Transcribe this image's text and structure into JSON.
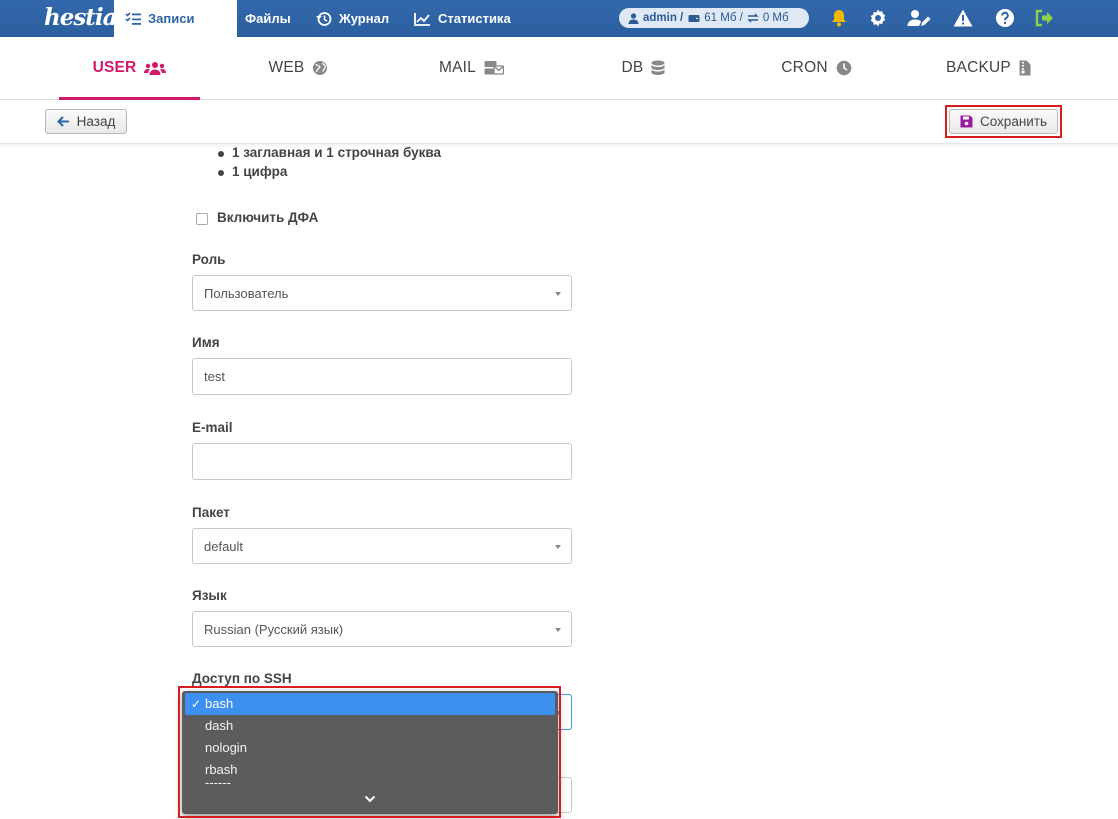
{
  "app": {
    "logo": "hestia"
  },
  "topnav": {
    "items": [
      {
        "label": "Записи",
        "icon": "list-check-icon",
        "active": true
      },
      {
        "label": "Файлы",
        "icon": "folder-icon",
        "active": false
      },
      {
        "label": "Журнал",
        "icon": "history-icon",
        "active": false
      },
      {
        "label": "Статистика",
        "icon": "chart-line-icon",
        "active": false
      }
    ],
    "user_pill": {
      "user": "admin /",
      "disk": "61 Мб /",
      "bandwidth": "0 Мб"
    },
    "icons": [
      "bell-icon",
      "gear-icon",
      "user-pen-icon",
      "warning-icon",
      "help-icon",
      "logout-icon"
    ],
    "accent": "#2c66a8",
    "bell_color": "#f5b800",
    "logout_color": "#8fd14f"
  },
  "tabs": [
    {
      "label": "USER",
      "icon": "users-icon",
      "active": true
    },
    {
      "label": "WEB",
      "icon": "globe-icon",
      "active": false
    },
    {
      "label": "MAIL",
      "icon": "mail-server-icon",
      "active": false
    },
    {
      "label": "DB",
      "icon": "database-icon",
      "active": false
    },
    {
      "label": "CRON",
      "icon": "clock-icon",
      "active": false
    },
    {
      "label": "BACKUP",
      "icon": "file-zip-icon",
      "active": false
    }
  ],
  "tab_accent": "#d0196a",
  "toolbar": {
    "back_label": "Назад",
    "save_label": "Сохранить"
  },
  "form": {
    "password_rules": [
      "1 заглавная и 1 строчная буква",
      "1 цифра"
    ],
    "mfa_label": "Включить ДФА",
    "role": {
      "label": "Роль",
      "value": "Пользователь"
    },
    "name": {
      "label": "Имя",
      "value": "test"
    },
    "email": {
      "label": "E-mail",
      "value": ""
    },
    "package": {
      "label": "Пакет",
      "value": "default"
    },
    "language": {
      "label": "Язык",
      "value": "Russian (Русский язык)"
    },
    "ssh": {
      "label": "Доступ по SSH"
    }
  },
  "ssh_dropdown": {
    "options": [
      "bash",
      "dash",
      "nologin",
      "rbash",
      "------"
    ],
    "selected": "bash",
    "check": "✓"
  }
}
